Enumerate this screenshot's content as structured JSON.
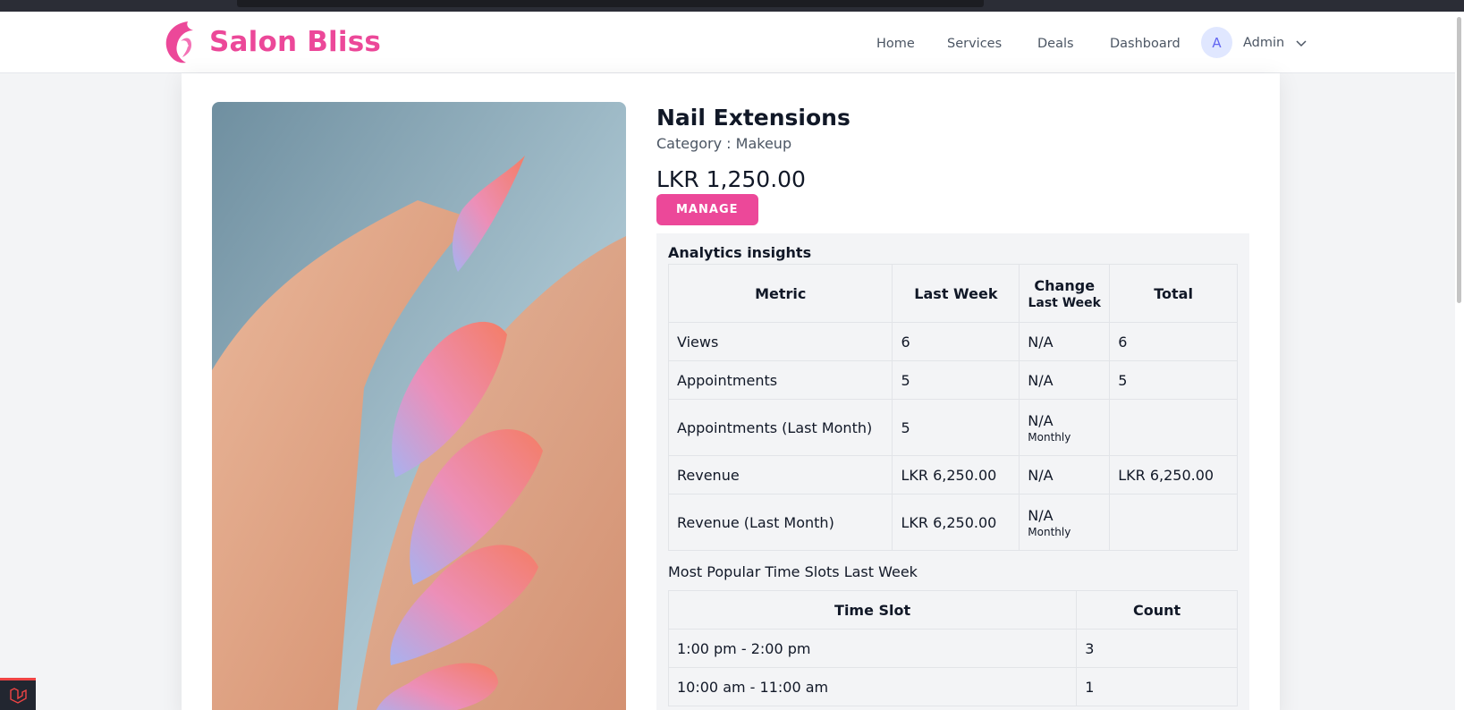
{
  "brand": {
    "name": "Salon Bliss",
    "accent_color": "#ec4899"
  },
  "nav": {
    "links": [
      {
        "label": "Home"
      },
      {
        "label": "Services"
      },
      {
        "label": "Deals"
      },
      {
        "label": "Dashboard"
      }
    ],
    "user": {
      "initial": "A",
      "name": "Admin"
    }
  },
  "service": {
    "title": "Nail Extensions",
    "category": "Category : Makeup",
    "price": "LKR 1,250.00",
    "manage_label": "MANAGE",
    "image_icon": "nail-photo"
  },
  "analytics": {
    "title": "Analytics insights",
    "headers": {
      "metric": "Metric",
      "last_week": "Last Week",
      "change": "Change",
      "change_sub": "Last Week",
      "total": "Total"
    },
    "rows": [
      {
        "metric": "Views",
        "last_week": "6",
        "change": "N/A",
        "change_sub": "",
        "total": "6"
      },
      {
        "metric": "Appointments",
        "last_week": "5",
        "change": "N/A",
        "change_sub": "",
        "total": "5"
      },
      {
        "metric": "Appointments (Last Month)",
        "last_week": "5",
        "change": "N/A",
        "change_sub": "Monthly",
        "total": ""
      },
      {
        "metric": "Revenue",
        "last_week": "LKR 6,250.00",
        "change": "N/A",
        "change_sub": "",
        "total": "LKR 6,250.00"
      },
      {
        "metric": "Revenue (Last Month)",
        "last_week": "LKR 6,250.00",
        "change": "N/A",
        "change_sub": "Monthly",
        "total": ""
      }
    ],
    "slots_title": "Most Popular Time Slots Last Week",
    "slots_headers": {
      "slot": "Time Slot",
      "count": "Count"
    },
    "slots": [
      {
        "slot": "1:00 pm - 2:00 pm",
        "count": "3"
      },
      {
        "slot": "10:00 am - 11:00 am",
        "count": "1"
      }
    ]
  }
}
